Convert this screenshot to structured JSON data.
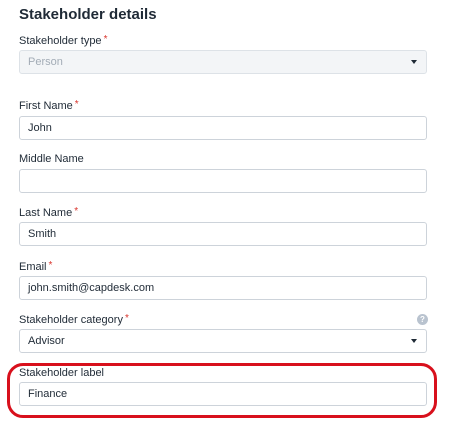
{
  "section": {
    "title": "Stakeholder details"
  },
  "required_marker": "*",
  "fields": {
    "stakeholder_type": {
      "label": "Stakeholder type",
      "value": "Person"
    },
    "first_name": {
      "label": "First Name",
      "value": "John"
    },
    "middle_name": {
      "label": "Middle Name",
      "value": ""
    },
    "last_name": {
      "label": "Last Name",
      "value": "Smith"
    },
    "email": {
      "label": "Email",
      "value": "john.smith@capdesk.com"
    },
    "stakeholder_category": {
      "label": "Stakeholder category",
      "value": "Advisor",
      "help": "?"
    },
    "stakeholder_label": {
      "label": "Stakeholder label",
      "value": "Finance"
    }
  },
  "colors": {
    "required": "#d9332b",
    "highlight": "#d8101c",
    "border": "#cdd3da"
  },
  "icons": {
    "dropdown": "chevron-down-icon",
    "help": "help-icon"
  }
}
